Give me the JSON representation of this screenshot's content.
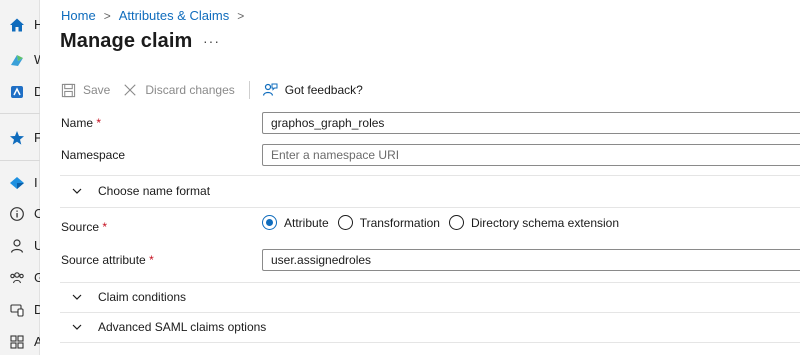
{
  "rail": {
    "items": [
      {
        "icon": "home-icon",
        "label": "H"
      },
      {
        "icon": "whats-new-icon",
        "label": "W"
      },
      {
        "icon": "diagnose-icon",
        "label": "D"
      },
      {
        "icon": "favorites-star-icon",
        "label": "F"
      },
      {
        "icon": "identity-icon",
        "label": "I"
      },
      {
        "icon": "info-icon",
        "label": "O"
      },
      {
        "icon": "user-icon",
        "label": "U"
      },
      {
        "icon": "groups-icon",
        "label": "G"
      },
      {
        "icon": "devices-icon",
        "label": "D"
      },
      {
        "icon": "apps-icon",
        "label": "A"
      }
    ]
  },
  "breadcrumb": {
    "items": [
      "Home",
      "Attributes & Claims"
    ],
    "separator": ">"
  },
  "page": {
    "title": "Manage claim",
    "more": "···"
  },
  "toolbar": {
    "save": "Save",
    "discard": "Discard changes",
    "feedback": "Got feedback?"
  },
  "form": {
    "name": {
      "label": "Name",
      "required": "*",
      "value": "graphos_graph_roles"
    },
    "namespace": {
      "label": "Namespace",
      "placeholder": "Enter a namespace URI"
    },
    "name_format": {
      "label": "Choose name format"
    },
    "source": {
      "label": "Source",
      "required": "*",
      "options": [
        "Attribute",
        "Transformation",
        "Directory schema extension"
      ],
      "selected": "Attribute"
    },
    "source_attribute": {
      "label": "Source attribute",
      "required": "*",
      "value": "user.assignedroles"
    },
    "claim_conditions": {
      "label": "Claim conditions"
    },
    "advanced_saml": {
      "label": "Advanced SAML claims options"
    }
  },
  "colors": {
    "accent": "#0f6cbd",
    "required": "#c50f1f",
    "rail_bg": "#f3f3f3"
  }
}
